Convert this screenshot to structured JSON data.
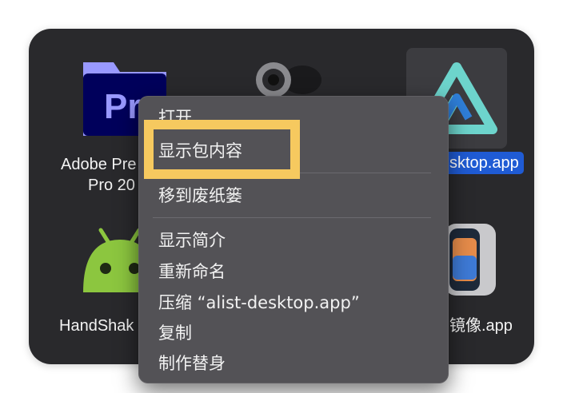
{
  "finder": {
    "files": [
      {
        "name_line1": "Adobe Pre",
        "name_line2": "Pro 20",
        "icon": "premiere-icon"
      },
      {
        "name": "",
        "icon": "webcam-icon"
      },
      {
        "name": "sktop.app",
        "icon": "alist-icon",
        "selected": true
      },
      {
        "name": "HandShak",
        "icon": "android-icon"
      },
      {
        "name": "镜像.app",
        "icon": "iphone-mirroring-icon"
      }
    ]
  },
  "context_menu": {
    "items": [
      {
        "label": "打开"
      },
      {
        "label": "显示包内容",
        "highlighted": true
      },
      {
        "label": "移到废纸篓"
      },
      {
        "label": "显示简介"
      },
      {
        "label": "重新命名"
      },
      {
        "label": "压缩 “alist-desktop.app”"
      },
      {
        "label": "复制"
      },
      {
        "label": "制作替身"
      }
    ]
  },
  "colors": {
    "window_bg": "#29292c",
    "menu_bg": "#535256",
    "highlight_border": "#f6c95f",
    "selection_blue": "#1f5bd4"
  }
}
